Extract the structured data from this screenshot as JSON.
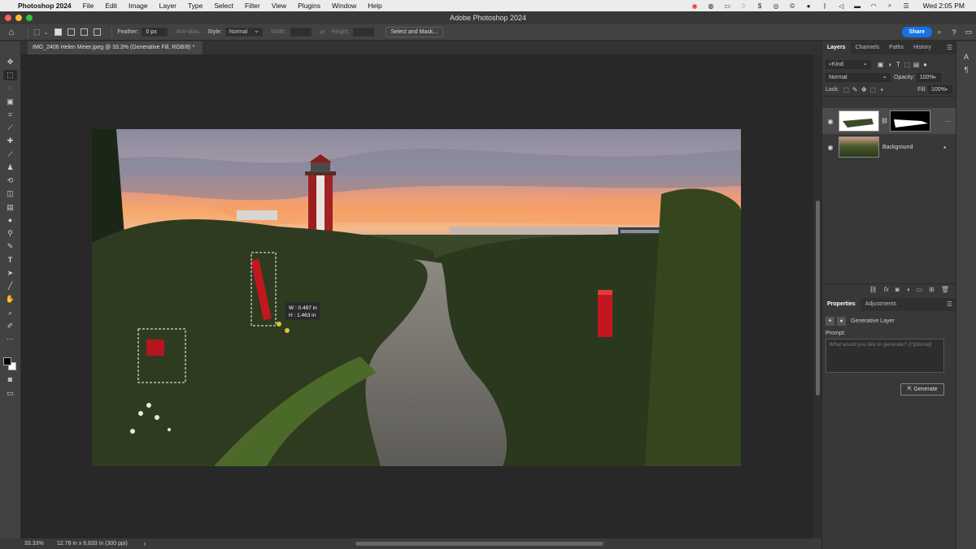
{
  "menubar": {
    "app": "Photoshop 2024",
    "items": [
      "File",
      "Edit",
      "Image",
      "Layer",
      "Type",
      "Select",
      "Filter",
      "View",
      "Plugins",
      "Window",
      "Help"
    ],
    "clock": "Wed 2:05 PM"
  },
  "window": {
    "title": "Adobe Photoshop 2024"
  },
  "options": {
    "feather_label": "Feather:",
    "feather_value": "0 px",
    "antialias_label": "Anti-alias",
    "style_label": "Style:",
    "style_value": "Normal",
    "width_label": "Width:",
    "height_label": "Height:",
    "select_mask_label": "Select and Mask...",
    "share_label": "Share"
  },
  "document": {
    "tab_title": "IMG_2406 Helen Meier.jpeg @ 33.3% (Generative Fill, RGB/8) *",
    "tooltip_w": "W : 0.497 in",
    "tooltip_h": "H : 1.463 in"
  },
  "status": {
    "zoom": "33.33%",
    "doc_info": "12.78 in x 6.633 in (300 ppi)"
  },
  "layers_panel": {
    "tabs": [
      "Layers",
      "Channels",
      "Paths",
      "History"
    ],
    "filter_value": "Kind",
    "blend_mode": "Normal",
    "opacity_label": "Opacity:",
    "opacity_value": "100%",
    "lock_label": "Lock:",
    "fill_label": "Fill:",
    "fill_value": "100%",
    "layers": [
      {
        "name": "",
        "selected": true
      },
      {
        "name": "Background",
        "selected": false
      }
    ]
  },
  "properties_panel": {
    "tabs": [
      "Properties",
      "Adjustments"
    ],
    "layer_type": "Generative Layer",
    "prompt_label": "Prompt:",
    "prompt_placeholder": "What would you like to generate? (Optional)",
    "generate_label": "Generate"
  },
  "colors": {
    "share_blue": "#1473e6",
    "red_close": "#ff5f57",
    "yellow_min": "#febc2e",
    "green_max": "#28c840"
  }
}
